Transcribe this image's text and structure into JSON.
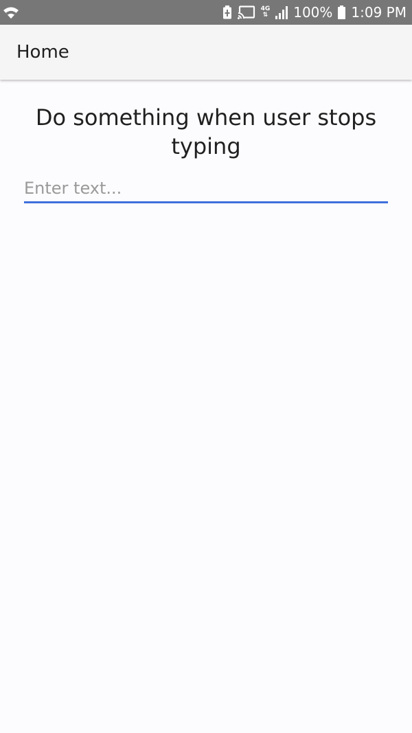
{
  "status_bar": {
    "battery_percent": "100%",
    "time": "1:09 PM",
    "network_label": "4G",
    "icons": [
      "wifi-icon",
      "battery-saver-icon",
      "cast-icon",
      "network-icon",
      "signal-icon",
      "battery-icon"
    ]
  },
  "app_bar": {
    "title": "Home"
  },
  "main": {
    "heading": "Do something when user stops typing",
    "input": {
      "placeholder": "Enter text...",
      "value": ""
    }
  },
  "colors": {
    "status_bar_bg": "#777777",
    "app_bar_bg": "#f5f5f5",
    "page_bg": "#fcfbfd",
    "input_underline": "#3f6fdc"
  }
}
